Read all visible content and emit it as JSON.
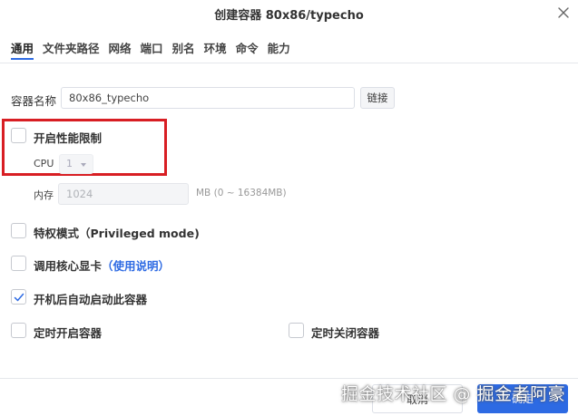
{
  "dialog": {
    "title": "创建容器 80x86/typecho"
  },
  "tabs": [
    {
      "label": "通用"
    },
    {
      "label": "文件夹路径"
    },
    {
      "label": "网络"
    },
    {
      "label": "端口"
    },
    {
      "label": "别名"
    },
    {
      "label": "环境"
    },
    {
      "label": "命令"
    },
    {
      "label": "能力"
    }
  ],
  "container_name": {
    "label": "容器名称",
    "value": "80x86_typecho",
    "link_button": "链接"
  },
  "perf_limit": {
    "label": "开启性能限制",
    "checked": false,
    "cpu_label": "CPU",
    "cpu_value": "1",
    "memory_label": "内存",
    "memory_value": "1024",
    "memory_unit": "MB (0 ~ 16384MB)"
  },
  "options": {
    "privileged": {
      "label": "特权模式（Privileged mode)",
      "checked": false
    },
    "gpu": {
      "label": "调用核心显卡",
      "hint": "（使用说明）",
      "checked": false
    },
    "autostart": {
      "label": "开机后自动启动此容器",
      "checked": true
    },
    "timed_start": {
      "label": "定时开启容器",
      "checked": false
    },
    "timed_stop": {
      "label": "定时关闭容器",
      "checked": false
    }
  },
  "footer": {
    "cancel": "取消",
    "confirm": "确定"
  },
  "watermark": "掘金技术社区 @ 掘金者阿豪",
  "colors": {
    "accent": "#2d6ae3",
    "highlight_box": "#d81e23"
  }
}
